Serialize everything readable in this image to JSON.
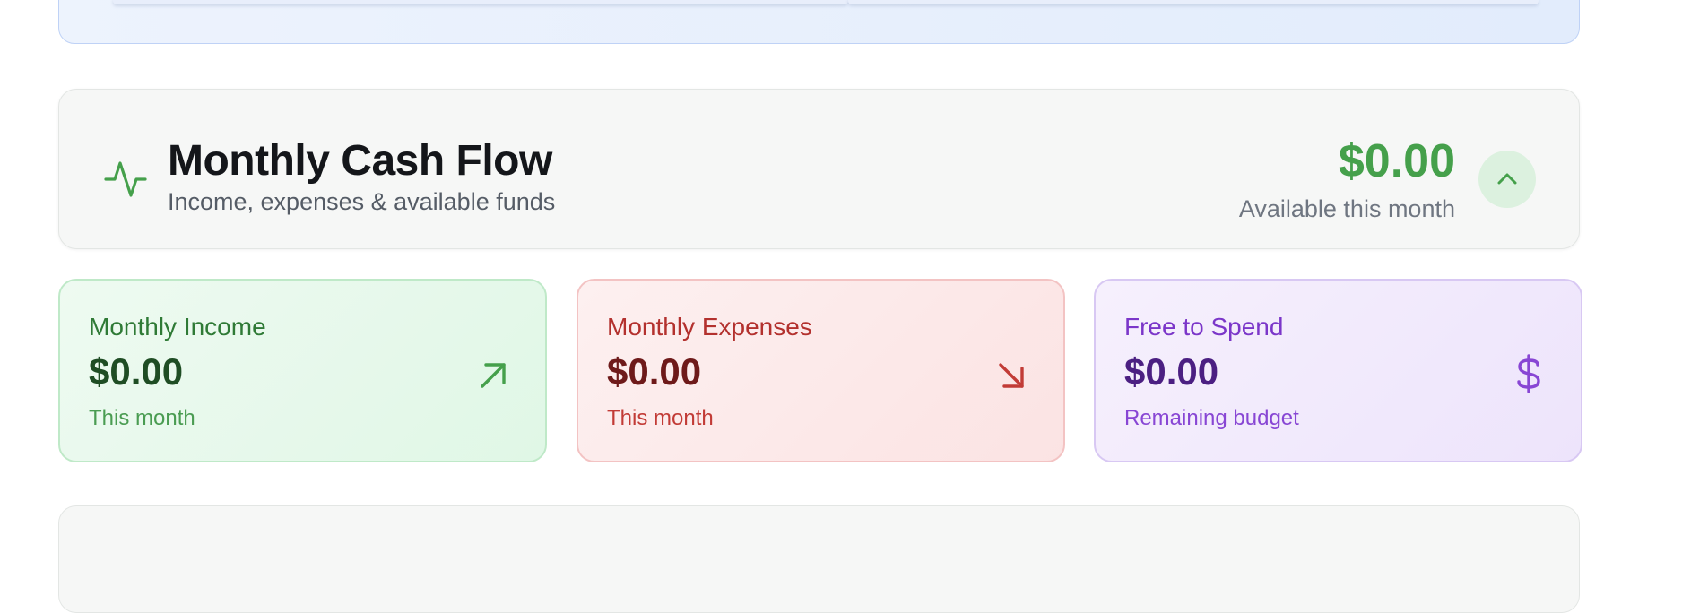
{
  "cashflow": {
    "title": "Monthly Cash Flow",
    "subtitle": "Income, expenses & available funds",
    "available_amount": "$0.00",
    "available_label": "Available this month",
    "icon": "activity-pulse-icon",
    "collapse_icon": "chevron-up-icon"
  },
  "stats": {
    "income": {
      "label": "Monthly Income",
      "value": "$0.00",
      "note": "This month",
      "icon": "arrow-up-right-icon"
    },
    "expenses": {
      "label": "Monthly Expenses",
      "value": "$0.00",
      "note": "This month",
      "icon": "arrow-down-right-icon"
    },
    "free": {
      "label": "Free to Spend",
      "value": "$0.00",
      "note": "Remaining budget",
      "icon": "dollar-icon"
    }
  },
  "colors": {
    "income_accent": "#45a04b",
    "expense_accent": "#c23b36",
    "free_accent": "#8846d4"
  }
}
